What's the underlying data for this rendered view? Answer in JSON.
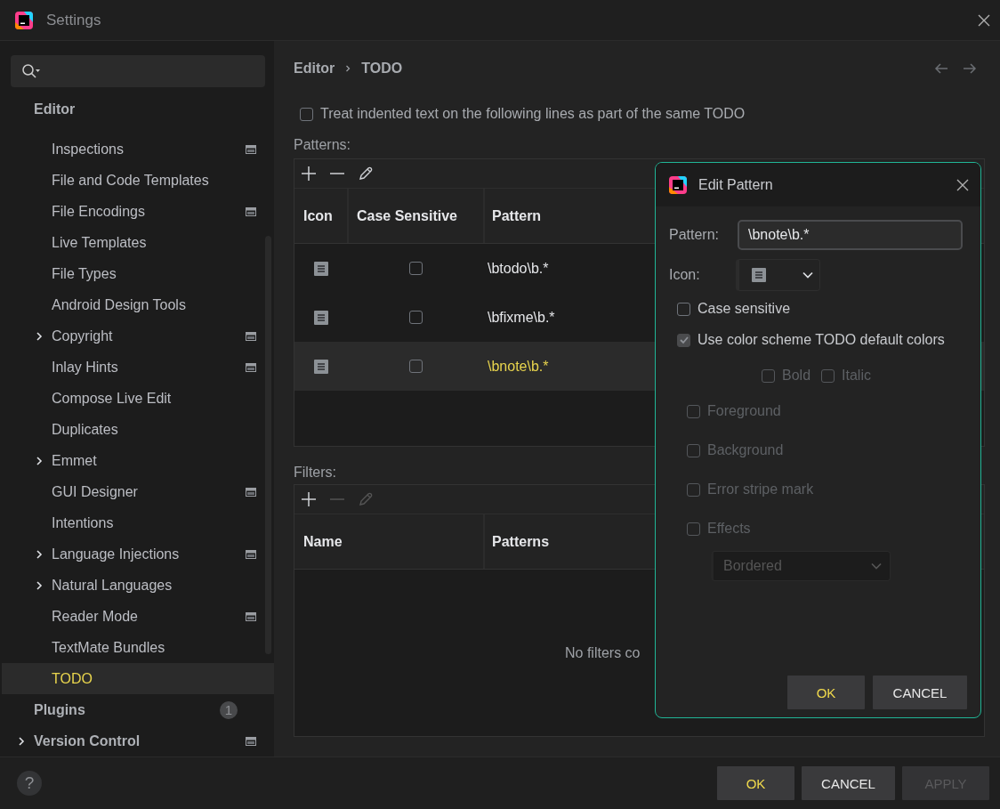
{
  "window": {
    "title": "Settings"
  },
  "sidebar": {
    "items": [
      {
        "label": "Editor",
        "kind": "section",
        "expandable": false,
        "project_icon": false,
        "selected": false,
        "children": [
          {
            "label": "Inspections",
            "kind": "item",
            "expandable": false,
            "project_icon": true,
            "selected": false
          },
          {
            "label": "File and Code Templates",
            "kind": "item",
            "expandable": false,
            "project_icon": false,
            "selected": false
          },
          {
            "label": "File Encodings",
            "kind": "item",
            "expandable": false,
            "project_icon": true,
            "selected": false
          },
          {
            "label": "Live Templates",
            "kind": "item",
            "expandable": false,
            "project_icon": false,
            "selected": false
          },
          {
            "label": "File Types",
            "kind": "item",
            "expandable": false,
            "project_icon": false,
            "selected": false
          },
          {
            "label": "Android Design Tools",
            "kind": "item",
            "expandable": false,
            "project_icon": false,
            "selected": false
          },
          {
            "label": "Copyright",
            "kind": "item",
            "expandable": true,
            "project_icon": true,
            "selected": false
          },
          {
            "label": "Inlay Hints",
            "kind": "item",
            "expandable": false,
            "project_icon": true,
            "selected": false
          },
          {
            "label": "Compose Live Edit",
            "kind": "item",
            "expandable": false,
            "project_icon": false,
            "selected": false
          },
          {
            "label": "Duplicates",
            "kind": "item",
            "expandable": false,
            "project_icon": false,
            "selected": false
          },
          {
            "label": "Emmet",
            "kind": "item",
            "expandable": true,
            "project_icon": false,
            "selected": false
          },
          {
            "label": "GUI Designer",
            "kind": "item",
            "expandable": false,
            "project_icon": true,
            "selected": false
          },
          {
            "label": "Intentions",
            "kind": "item",
            "expandable": false,
            "project_icon": false,
            "selected": false
          },
          {
            "label": "Language Injections",
            "kind": "item",
            "expandable": true,
            "project_icon": true,
            "selected": false
          },
          {
            "label": "Natural Languages",
            "kind": "item",
            "expandable": true,
            "project_icon": false,
            "selected": false
          },
          {
            "label": "Reader Mode",
            "kind": "item",
            "expandable": false,
            "project_icon": true,
            "selected": false
          },
          {
            "label": "TextMate Bundles",
            "kind": "item",
            "expandable": false,
            "project_icon": false,
            "selected": false
          },
          {
            "label": "TODO",
            "kind": "item",
            "expandable": false,
            "project_icon": false,
            "selected": true
          }
        ]
      },
      {
        "label": "Plugins",
        "kind": "section",
        "expandable": false,
        "project_icon": false,
        "selected": false,
        "count": "1"
      },
      {
        "label": "Version Control",
        "kind": "section",
        "expandable": true,
        "project_icon": true,
        "selected": false
      }
    ]
  },
  "breadcrumb": [
    "Editor",
    "TODO"
  ],
  "multiline_option": {
    "label": "Treat indented text on the following lines as part of the same TODO",
    "checked": false
  },
  "patterns": {
    "label": "Patterns:",
    "toolbar": [
      {
        "kind": "add",
        "disabled": false
      },
      {
        "kind": "remove",
        "disabled": false
      },
      {
        "kind": "edit",
        "disabled": false
      }
    ],
    "columns": [
      "Icon",
      "Case Sensitive",
      "Pattern"
    ],
    "rows": [
      {
        "case_sensitive": false,
        "pattern": "\\btodo\\b.*",
        "selected": false
      },
      {
        "case_sensitive": false,
        "pattern": "\\bfixme\\b.*",
        "selected": false
      },
      {
        "case_sensitive": false,
        "pattern": "\\bnote\\b.*",
        "selected": true
      }
    ]
  },
  "filters": {
    "label": "Filters:",
    "toolbar": [
      {
        "kind": "add",
        "disabled": false
      },
      {
        "kind": "remove",
        "disabled": true
      },
      {
        "kind": "edit",
        "disabled": true
      }
    ],
    "columns": [
      "Name",
      "Patterns"
    ],
    "empty_text": "No filters co"
  },
  "dialog": {
    "title": "Edit Pattern",
    "pattern_label": "Pattern:",
    "pattern_value": "\\bnote\\b.*",
    "icon_label": "Icon:",
    "case_sensitive": {
      "label": "Case sensitive",
      "checked": false,
      "disabled": false
    },
    "default_colors": {
      "label": "Use color scheme TODO default colors",
      "checked": true,
      "disabled": false
    },
    "font_styles": [
      {
        "label": "Bold",
        "checked": false,
        "disabled": true
      },
      {
        "label": "Italic",
        "checked": false,
        "disabled": true
      }
    ],
    "attributes": [
      {
        "label": "Foreground",
        "checked": false,
        "disabled": true
      },
      {
        "label": "Background",
        "checked": false,
        "disabled": true
      },
      {
        "label": "Error stripe mark",
        "checked": false,
        "disabled": true
      },
      {
        "label": "Effects",
        "checked": false,
        "disabled": true
      }
    ],
    "effect_select": {
      "value": "Bordered",
      "disabled": true
    },
    "buttons": [
      {
        "label": "OK",
        "kind": "default",
        "disabled": false
      },
      {
        "label": "CANCEL",
        "kind": "normal",
        "disabled": false
      }
    ]
  },
  "footer": {
    "help": "?",
    "buttons": [
      {
        "label": "OK",
        "kind": "default",
        "disabled": false
      },
      {
        "label": "CANCEL",
        "kind": "normal",
        "disabled": false
      },
      {
        "label": "APPLY",
        "kind": "normal",
        "disabled": true
      }
    ]
  }
}
